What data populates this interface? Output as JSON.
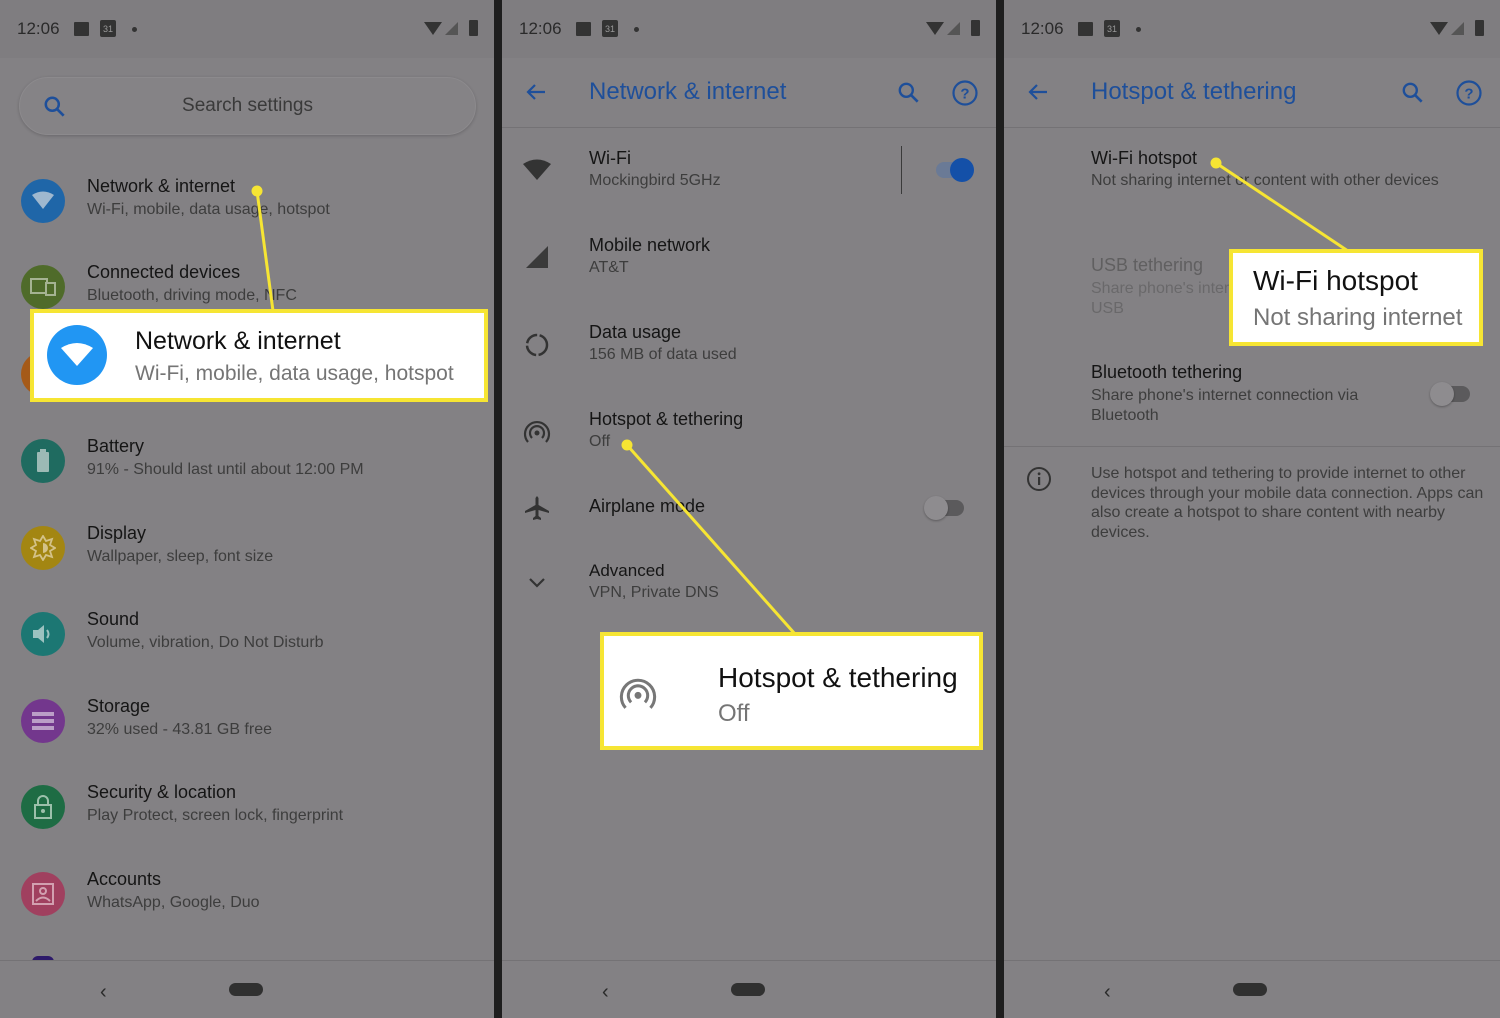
{
  "status_bar": {
    "time": "12:06",
    "calendar_day": "31"
  },
  "panel1": {
    "search": {
      "placeholder": "Search settings"
    },
    "items": [
      {
        "title": "Network & internet",
        "subtitle": "Wi-Fi, mobile, data usage, hotspot",
        "icon": "wifi-icon",
        "color": "#1f66a8"
      },
      {
        "title": "Connected devices",
        "subtitle": "Bluetooth, driving mode, NFC",
        "icon": "devices-icon",
        "color": "#4f6b2a"
      },
      {
        "title": "Battery",
        "subtitle": "91% - Should last until about 12:00 PM",
        "icon": "battery-icon",
        "color": "#1f6b60"
      },
      {
        "title": "Display",
        "subtitle": "Wallpaper, sleep, font size",
        "icon": "brightness-icon",
        "color": "#a38612"
      },
      {
        "title": "Sound",
        "subtitle": "Volume, vibration, Do Not Disturb",
        "icon": "volume-icon",
        "color": "#1c7773"
      },
      {
        "title": "Storage",
        "subtitle": "32% used - 43.81 GB free",
        "icon": "storage-icon",
        "color": "#73378d"
      },
      {
        "title": "Security & location",
        "subtitle": "Play Protect, screen lock, fingerprint",
        "icon": "lock-icon",
        "color": "#1e6c44"
      },
      {
        "title": "Accounts",
        "subtitle": "WhatsApp, Google, Duo",
        "icon": "account-icon",
        "color": "#a0405f"
      }
    ],
    "callout": {
      "title": "Network & internet",
      "subtitle": "Wi-Fi, mobile, data usage, hotspot"
    }
  },
  "panel2": {
    "title": "Network & internet",
    "items": [
      {
        "title": "Wi-Fi",
        "subtitle": "Mockingbird 5GHz",
        "toggle": true
      },
      {
        "title": "Mobile network",
        "subtitle": "AT&T"
      },
      {
        "title": "Data usage",
        "subtitle": "156 MB of data used"
      },
      {
        "title": "Hotspot & tethering",
        "subtitle": "Off"
      },
      {
        "title": "Airplane mode",
        "toggle": false
      },
      {
        "title": "Advanced",
        "subtitle": "VPN, Private DNS"
      }
    ],
    "callout": {
      "title": "Hotspot & tethering",
      "subtitle": "Off"
    }
  },
  "panel3": {
    "title": "Hotspot & tethering",
    "items": [
      {
        "title": "Wi-Fi hotspot",
        "subtitle": "Not sharing internet or content with other devices"
      },
      {
        "title": "USB tethering",
        "subtitle_line1": "Share phone's internet connection via",
        "subtitle_line2": "USB",
        "disabled": true
      },
      {
        "title": "Bluetooth tethering",
        "subtitle_line1": "Share phone's internet connection via",
        "subtitle_line2": "Bluetooth",
        "toggle": false
      }
    ],
    "info": "Use hotspot and tethering to provide internet to other devices through your mobile data connection. Apps can also create a hotspot to share content with nearby devices.",
    "callout": {
      "title": "Wi-Fi hotspot",
      "subtitle": "Not sharing internet"
    }
  },
  "colors": {
    "accent": "#1e4f9a",
    "highlight": "#f6e533",
    "toggle_on": "#1450a8"
  }
}
